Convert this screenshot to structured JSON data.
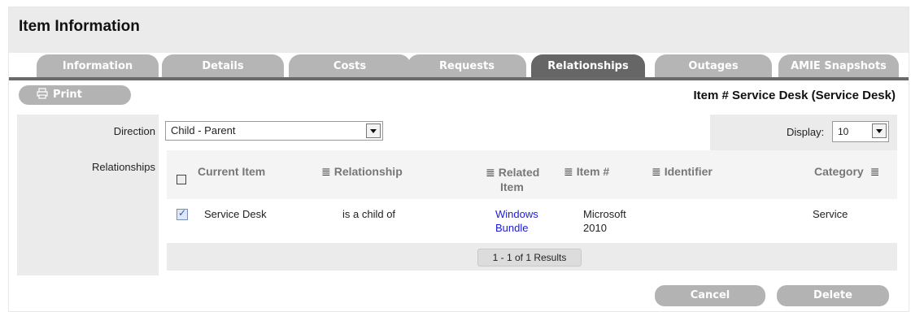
{
  "panel": {
    "title": "Item Information"
  },
  "tabs": [
    {
      "label": "Information",
      "active": false
    },
    {
      "label": "Details",
      "active": false
    },
    {
      "label": "Costs",
      "active": false
    },
    {
      "label": "Requests",
      "active": false
    },
    {
      "label": "Relationships",
      "active": true
    },
    {
      "label": "Outages",
      "active": false
    },
    {
      "label": "AMIE Snapshots",
      "active": false
    }
  ],
  "toolbar": {
    "print_label": "Print",
    "print_icon": "printer-icon"
  },
  "item_number": "Item # Service Desk (Service Desk)",
  "form": {
    "direction_label": "Direction",
    "direction_value": "Child - Parent",
    "relationships_label": "Relationships",
    "display_label": "Display:",
    "display_value": "10"
  },
  "table": {
    "columns": {
      "current_item": "Current Item",
      "relationship": "Relationship",
      "related_item_1": "Related",
      "related_item_2": "Item",
      "item_number": "Item #",
      "identifier": "Identifier",
      "category": "Category"
    },
    "sort_icon": "list-icon",
    "rows": [
      {
        "checked": true,
        "current_item": "Service Desk",
        "relationship": "is a child of",
        "related_item_1": "Windows",
        "related_item_2": "Bundle",
        "item_number_1": "Microsoft",
        "item_number_2": "2010",
        "identifier": "",
        "category": "Service"
      }
    ],
    "results": "1 - 1 of 1 Results"
  },
  "actions": {
    "cancel_label": "Cancel",
    "delete_label": "Delete"
  },
  "colors": {
    "tab_active": "#666666",
    "tab_inactive": "#b5b5b5",
    "link": "#1a1adb"
  }
}
